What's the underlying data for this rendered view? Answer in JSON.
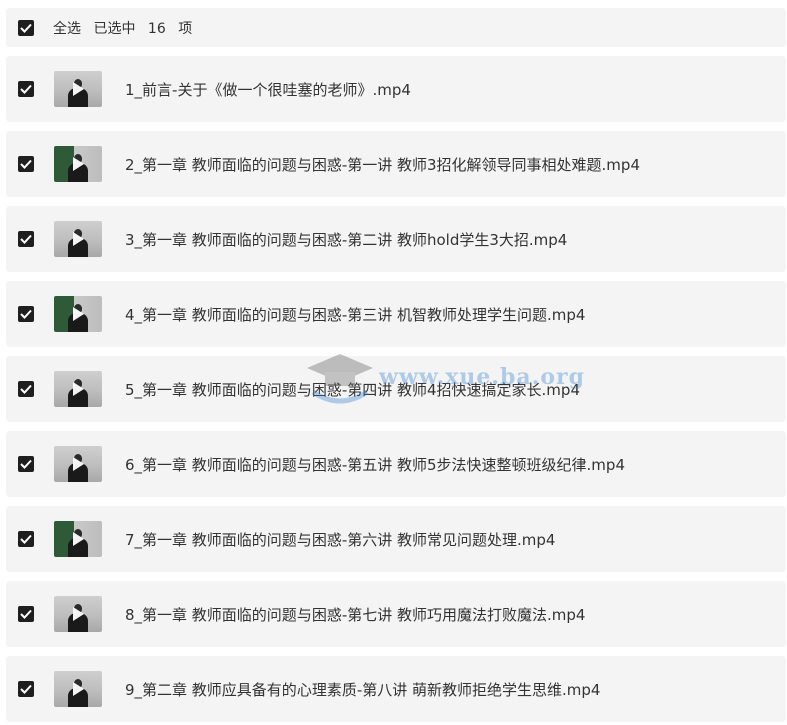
{
  "header": {
    "select_all": "全选",
    "selected_prefix": "已选中",
    "selected_count": "16",
    "selected_suffix": "项"
  },
  "files": [
    {
      "title": "1_前言-关于《做一个很哇塞的老师》.mp4",
      "thumb": "light"
    },
    {
      "title": "2_第一章 教师面临的问题与困惑-第一讲 教师3招化解领导同事相处难题.mp4",
      "thumb": "board"
    },
    {
      "title": "3_第一章 教师面临的问题与困惑-第二讲 教师hold学生3大招.mp4",
      "thumb": "light"
    },
    {
      "title": "4_第一章 教师面临的问题与困惑-第三讲 机智教师处理学生问题.mp4",
      "thumb": "board"
    },
    {
      "title": "5_第一章 教师面临的问题与困惑-第四讲 教师4招快速搞定家长.mp4",
      "thumb": "light"
    },
    {
      "title": "6_第一章 教师面临的问题与困惑-第五讲 教师5步法快速整顿班级纪律.mp4",
      "thumb": "light"
    },
    {
      "title": "7_第一章 教师面临的问题与困惑-第六讲 教师常见问题处理.mp4",
      "thumb": "board"
    },
    {
      "title": "8_第一章 教师面临的问题与困惑-第七讲 教师巧用魔法打败魔法.mp4",
      "thumb": "light"
    },
    {
      "title": "9_第二章 教师应具备有的心理素质-第八讲 萌新教师拒绝学生思维.mp4",
      "thumb": "light"
    }
  ],
  "watermark": {
    "text": "www.xue.ba.org"
  },
  "colors": {
    "row_bg": "#f4f4f5",
    "checkbox": "#1f1f1f",
    "text": "#333333"
  }
}
